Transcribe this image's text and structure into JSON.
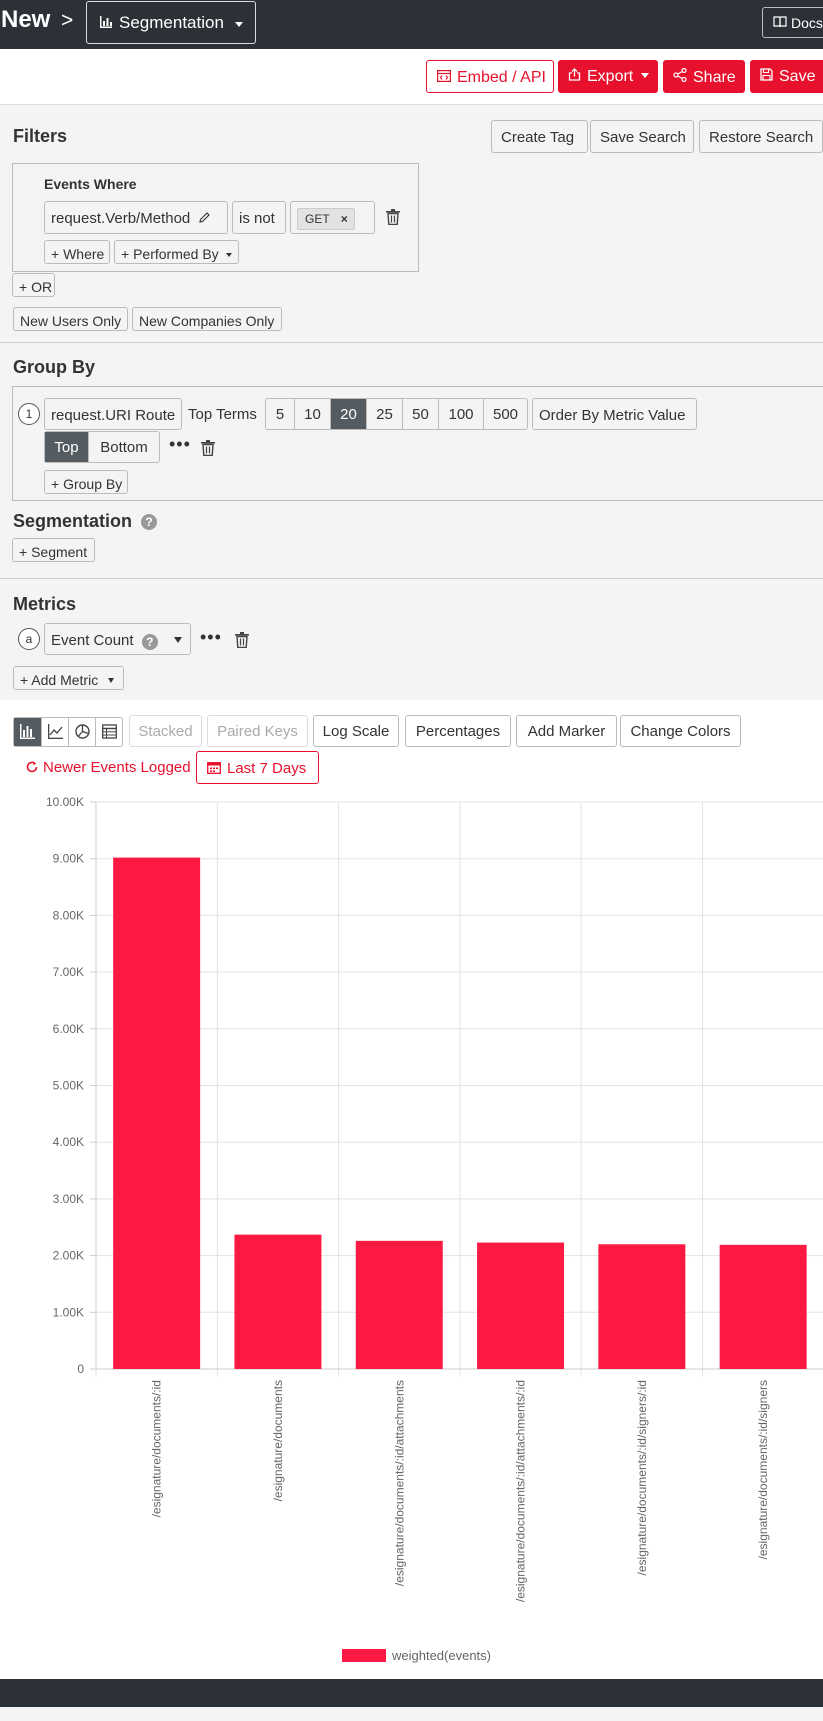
{
  "topbar": {
    "new_label": "New",
    "separator": ">",
    "view_dropdown_label": "Segmentation",
    "docs_label": "Docs"
  },
  "actions": {
    "embed_label": "Embed / API",
    "export_label": "Export",
    "share_label": "Share",
    "save_label": "Save"
  },
  "filters": {
    "title": "Filters",
    "create_tag": "Create Tag",
    "save_search": "Save Search",
    "restore_search": "Restore Search",
    "events_where": "Events Where",
    "field": "request.Verb/Method",
    "operator": "is not",
    "value_tag": "GET",
    "add_where": "+ Where",
    "performed_by": "+ Performed By",
    "or_button": "+ OR",
    "new_users_only": "New Users Only",
    "new_companies_only": "New Companies Only"
  },
  "group_by": {
    "title": "Group By",
    "index": "1",
    "field": "request.URI Route",
    "top_terms_label": "Top Terms",
    "term_options": [
      "5",
      "10",
      "20",
      "25",
      "50",
      "100",
      "500"
    ],
    "selected_term": "20",
    "order_by": "Order By Metric Value",
    "direction_options": [
      "Top",
      "Bottom"
    ],
    "selected_direction": "Top",
    "add_group_by": "+ Group By"
  },
  "segmentation": {
    "title": "Segmentation",
    "help": "?",
    "add_segment": "+ Segment"
  },
  "metrics": {
    "title": "Metrics",
    "index": "a",
    "metric": "Event Count",
    "help": "?",
    "add_metric": "+ Add Metric"
  },
  "chart_toolbar": {
    "stacked": "Stacked",
    "paired_keys": "Paired Keys",
    "log_scale": "Log Scale",
    "percentages": "Percentages",
    "add_marker": "Add Marker",
    "change_colors": "Change Colors",
    "newer_events": "Newer Events Logged",
    "date_range": "Last 7 Days"
  },
  "colors": {
    "brand_red": "#e8112d",
    "bar_color": "#fc1a43",
    "dark_bar": "#2b3137"
  },
  "chart_data": {
    "type": "bar",
    "categories": [
      "/esignature/documents/:id",
      "/esignature/documents",
      "/esignature/documents/:id/attachments",
      "/esignature/documents/:id/attachments/:id",
      "/esignature/documents/:id/signers/:id",
      "/esignature/documents/:id/signers"
    ],
    "series": [
      {
        "name": "weighted(events)",
        "values": [
          9020,
          2370,
          2260,
          2230,
          2200,
          2190
        ]
      }
    ],
    "y_ticks": [
      "0",
      "1.00K",
      "2.00K",
      "3.00K",
      "4.00K",
      "5.00K",
      "6.00K",
      "7.00K",
      "8.00K",
      "9.00K",
      "10.00K"
    ],
    "ylim": [
      0,
      10000
    ],
    "grid": true,
    "legend_position": "bottom"
  }
}
